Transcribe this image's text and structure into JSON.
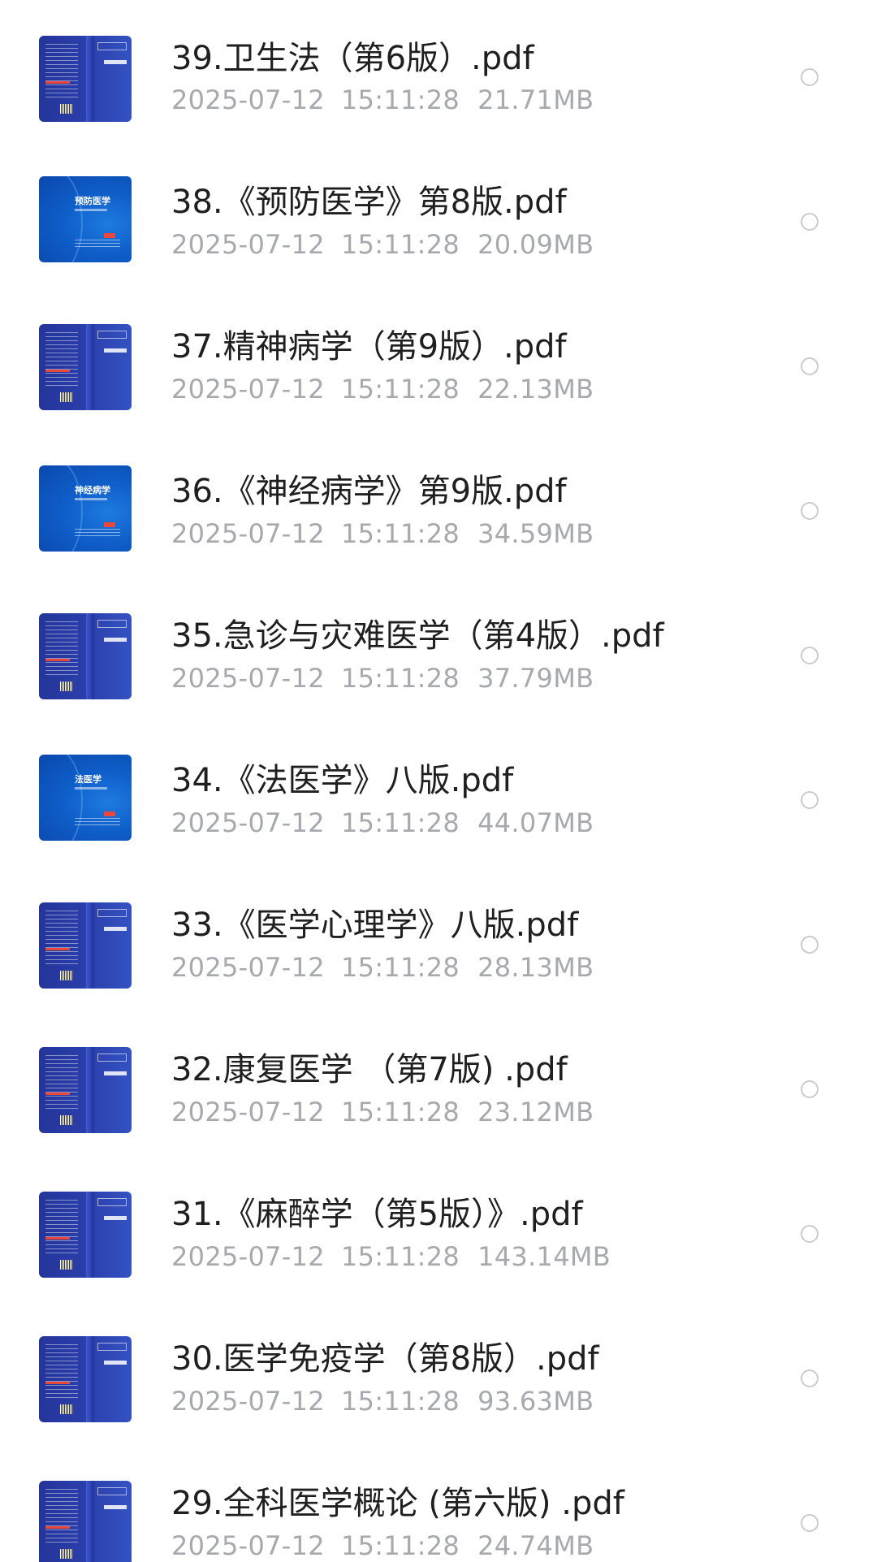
{
  "files": [
    {
      "name": "39.卫生法（第6版）.pdf",
      "date": "2025-07-12",
      "time": "15:11:28",
      "size": "21.71MB",
      "thumb": "back",
      "cover_title": ""
    },
    {
      "name": "38.《预防医学》第8版.pdf",
      "date": "2025-07-12",
      "time": "15:11:28",
      "size": "20.09MB",
      "thumb": "front",
      "cover_title": "预防医学"
    },
    {
      "name": "37.精神病学（第9版）.pdf",
      "date": "2025-07-12",
      "time": "15:11:28",
      "size": "22.13MB",
      "thumb": "back",
      "cover_title": ""
    },
    {
      "name": "36.《神经病学》第9版.pdf",
      "date": "2025-07-12",
      "time": "15:11:28",
      "size": "34.59MB",
      "thumb": "front",
      "cover_title": "神经病学"
    },
    {
      "name": "35.急诊与灾难医学（第4版）.pdf",
      "date": "2025-07-12",
      "time": "15:11:28",
      "size": "37.79MB",
      "thumb": "back",
      "cover_title": ""
    },
    {
      "name": "34.《法医学》八版.pdf",
      "date": "2025-07-12",
      "time": "15:11:28",
      "size": "44.07MB",
      "thumb": "front",
      "cover_title": "法医学"
    },
    {
      "name": "33.《医学心理学》八版.pdf",
      "date": "2025-07-12",
      "time": "15:11:28",
      "size": "28.13MB",
      "thumb": "back",
      "cover_title": ""
    },
    {
      "name": "32.康复医学 （第7版) .pdf",
      "date": "2025-07-12",
      "time": "15:11:28",
      "size": "23.12MB",
      "thumb": "back",
      "cover_title": ""
    },
    {
      "name": "31.《麻醉学（第5版）》.pdf",
      "date": "2025-07-12",
      "time": "15:11:28",
      "size": "143.14MB",
      "thumb": "back",
      "cover_title": ""
    },
    {
      "name": "30.医学免疫学（第8版）.pdf",
      "date": "2025-07-12",
      "time": "15:11:28",
      "size": "93.63MB",
      "thumb": "back",
      "cover_title": ""
    },
    {
      "name": "29.全科医学概论 (第六版) .pdf",
      "date": "2025-07-12",
      "time": "15:11:28",
      "size": "24.74MB",
      "thumb": "back",
      "cover_title": ""
    }
  ]
}
